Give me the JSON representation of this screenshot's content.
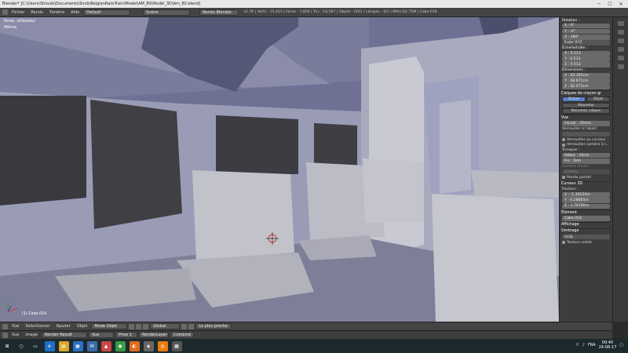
{
  "window": {
    "title": "Blender* [C:\\Users\\Shloulo\\Documents\\Sncb\\BelgianRailsTrain\\Model\\AM_80\\Model_3D\\Am_80.blend]",
    "minimize_icon": "minimize-icon",
    "maximize_icon": "maximize-icon",
    "close_icon": "close-icon"
  },
  "topbar": {
    "menus": [
      "Fichier",
      "Rendu",
      "Fenêtre",
      "Aide"
    ],
    "layout_select": "Default",
    "scene_select": "Scene",
    "render_engine": "Rendu Blender",
    "stats": "v2.78 | Verts : 15,413 | Faces : 7,804 | Tris : 16,587 | Objets : 0/41 | Lampes : 0/2 | Mém:62.75M | Cabe.016"
  },
  "viewport": {
    "view_label": "Persp. utilisateur",
    "unit_label": "Mètres",
    "object_label": "(1) Cabe.016",
    "sky_color": "#8c8fb8",
    "wall_color": "#a7a8bd",
    "seat_color": "#bdbdc6"
  },
  "properties": {
    "rotation": {
      "title": "Rotation :",
      "x": "X : 0°",
      "y": "Y : -0°",
      "z": "Z : 180°",
      "mode": "Euler XYZ"
    },
    "scale": {
      "title": "Échelle/taille :",
      "x": "X : 0.513",
      "y": "Y : 0.513",
      "z": "Z : 0.513"
    },
    "dimensions": {
      "title": "Dimensions :",
      "x": "X : 83.365cm",
      "y": "Y : 48.671cm",
      "z": "Z : 82.073cm"
    },
    "grease_pencil": {
      "title": "Calques de crayon gr",
      "tab_scene": "Scène",
      "tab_object": "Objet",
      "new_button": "Nouveau",
      "new_layer": "Nouveau calque"
    },
    "view": {
      "title": "Vue",
      "focal": "Focale : 35mm",
      "lock_to_object": "Verrouiller à l'objet :",
      "lock_cursor": "Verrouiller au curseur",
      "lock_camera": "Verrouiller caméra à l...",
      "clip_title": "Tronquer :",
      "clip_start": "Début : 10cm",
      "clip_end": "Fin : 1km",
      "local_camera_title": "Caméra locale :",
      "local_camera": "Caméra",
      "render_border": "Rendu partiel"
    },
    "cursor": {
      "title": "Curseur 3D",
      "location": "Position :",
      "x": "X : -1.30234m",
      "y": "Y : 6.28665m",
      "z": "Z : 1.76706m"
    },
    "item": {
      "title": "Élément",
      "name": "Cabe.016"
    },
    "display": {
      "title": "Affichage"
    },
    "shading": {
      "title": "Ombrage",
      "mode": "GLSL",
      "texture_solid": "Texture solide"
    }
  },
  "header3d": {
    "items": [
      "Vue",
      "Sélectionner",
      "Ajouter",
      "Objet"
    ],
    "mode": "Mode Objet",
    "orientation": "Global",
    "snap": "Le plus proche"
  },
  "header_image": {
    "items": [
      "Vue",
      "Image"
    ],
    "image_name": "Render Result",
    "view_menu": "Vue",
    "slot": "Prise 1",
    "layer": "RenderLayer",
    "pass": "Combiné"
  },
  "taskbar": {
    "icons": [
      "windows-icon",
      "search-icon",
      "task-view-icon",
      "edge-icon",
      "explorer-icon",
      "store-icon",
      "mail-icon",
      "photos-icon",
      "chrome-icon",
      "firefox-icon",
      "gimp-icon",
      "blender-icon",
      "app-icon"
    ],
    "language": "FRA",
    "time": "09:40",
    "date": "24-08-17"
  }
}
